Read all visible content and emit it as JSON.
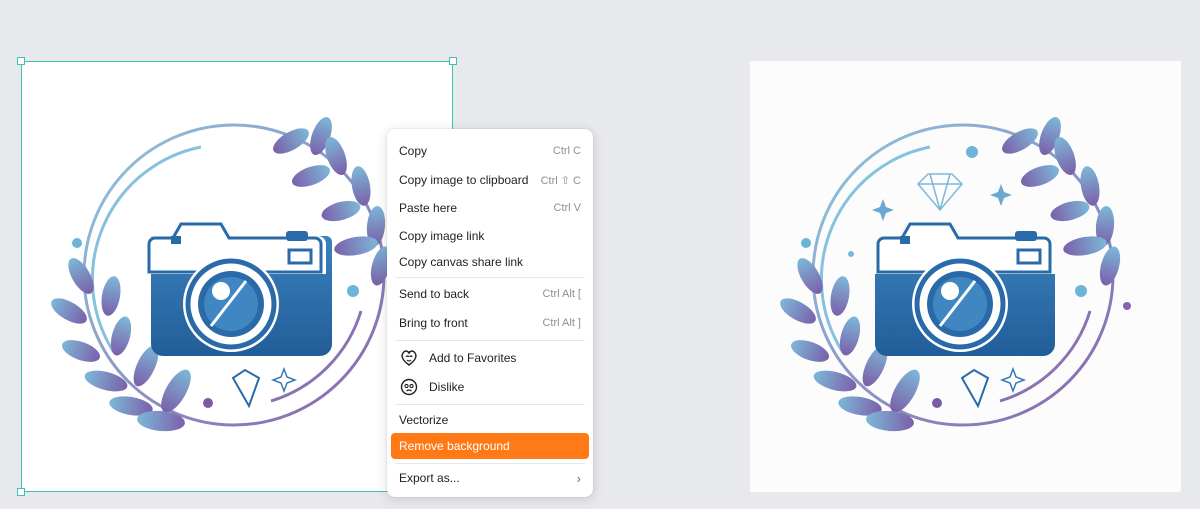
{
  "canvas": {
    "left_image": {
      "name": "camera-logo-original"
    },
    "right_image": {
      "name": "camera-logo-variant"
    }
  },
  "context_menu": {
    "copy": {
      "label": "Copy",
      "shortcut": "Ctrl C"
    },
    "copy_image": {
      "label": "Copy image to clipboard",
      "shortcut": "Ctrl ⇧ C"
    },
    "paste": {
      "label": "Paste here",
      "shortcut": "Ctrl V"
    },
    "copy_link": {
      "label": "Copy image link"
    },
    "copy_share": {
      "label": "Copy canvas share link"
    },
    "send_back": {
      "label": "Send to back",
      "shortcut": "Ctrl Alt ["
    },
    "bring_front": {
      "label": "Bring to front",
      "shortcut": "Ctrl Alt ]"
    },
    "favorite": {
      "label": "Add to Favorites",
      "icon": "heart-face-icon"
    },
    "dislike": {
      "label": "Dislike",
      "icon": "sad-face-icon"
    },
    "vectorize": {
      "label": "Vectorize"
    },
    "remove_bg": {
      "label": "Remove background"
    },
    "export": {
      "label": "Export as...",
      "icon": "chevron-right-icon"
    }
  },
  "colors": {
    "selection": "#3cc2b4",
    "highlight": "#ff7a16",
    "camera_blue": "#2c6aa6",
    "leaf_purple": "#7e63aa",
    "leaf_blue": "#6aa8cf"
  }
}
